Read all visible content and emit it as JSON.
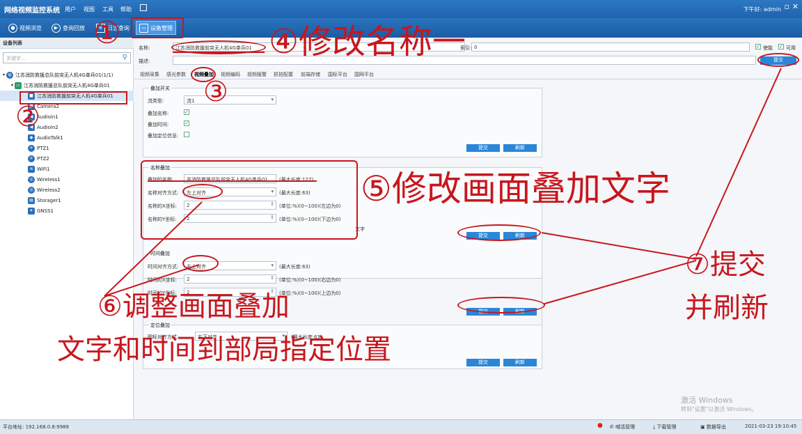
{
  "titlebar": {
    "app_title": "网络视频监控系统",
    "menus": [
      "用户",
      "视图",
      "工具",
      "帮助"
    ],
    "greeting": "下午好: admin",
    "window_controls": [
      "minimize-icon",
      "restore-icon",
      "close-icon"
    ]
  },
  "toolbar": {
    "buttons": [
      {
        "label": "视频浏览",
        "icon": "camera-icon"
      },
      {
        "label": "查询回放",
        "icon": "play-icon"
      },
      {
        "label": "日志查询",
        "icon": "log-icon"
      },
      {
        "label": "设备管理",
        "icon": "device-icon"
      }
    ]
  },
  "sidebar": {
    "header": "设备列表",
    "search_placeholder": "关键字...",
    "tree": [
      {
        "label": "江苏消防救援总队前突无人机4G单兵01(1/1)",
        "icon": "globe-icon",
        "level": 0,
        "color": "#2d6fb7"
      },
      {
        "label": "江苏消防救援总队前突无人机4G单兵01",
        "icon": "device-icon",
        "level": 1,
        "color": "#2a9a6a"
      },
      {
        "label": "江苏消防救援前突无人机4G单兵01",
        "icon": "camera-icon",
        "level": 2,
        "color": "#2d6fb7",
        "selected": true
      },
      {
        "label": "Camera2",
        "icon": "camera-icon",
        "level": 2,
        "color": "#2d6fb7"
      },
      {
        "label": "Audioin1",
        "icon": "speaker-icon",
        "level": 2,
        "color": "#2d6fb7"
      },
      {
        "label": "Audioin2",
        "icon": "speaker-icon",
        "level": 2,
        "color": "#2d6fb7"
      },
      {
        "label": "AudioTalk1",
        "icon": "talk-icon",
        "level": 2,
        "color": "#2d6fb7"
      },
      {
        "label": "PTZ1",
        "icon": "ptz-icon",
        "level": 2,
        "color": "#2d6fb7"
      },
      {
        "label": "PTZ2",
        "icon": "ptz-icon",
        "level": 2,
        "color": "#2d6fb7"
      },
      {
        "label": "WiFi1",
        "icon": "wifi-icon",
        "level": 2,
        "color": "#2d6fb7"
      },
      {
        "label": "Wireless1",
        "icon": "wireless-icon",
        "level": 2,
        "color": "#2d6fb7"
      },
      {
        "label": "Wireless2",
        "icon": "wireless-icon",
        "level": 2,
        "color": "#2d6fb7"
      },
      {
        "label": "Storager1",
        "icon": "storage-icon",
        "level": 2,
        "color": "#2d6fb7"
      },
      {
        "label": "GNSS1",
        "icon": "satellite-icon",
        "level": 2,
        "color": "#2d6fb7"
      }
    ]
  },
  "main": {
    "name_label": "名称:",
    "name_value": "江苏消防救援前突无人机4G单兵01",
    "index_label": "索引:",
    "index_value": "0",
    "desc_label": "描述:",
    "desc_value": "",
    "check_label_1": "使能",
    "check_label_2": "可用",
    "submit_top": "提交",
    "tabs": [
      "视频采集",
      "感光参数",
      "视频叠加",
      "视频编码",
      "视频报警",
      "抓拍配置",
      "前端存储",
      "国标平台",
      "国网平台"
    ],
    "active_tab": "视频叠加",
    "overlay_switch": {
      "title": "叠加开关",
      "stream_label": "流类型:",
      "stream_value": "流1",
      "rows": [
        {
          "label": "叠加名称:",
          "checked": true
        },
        {
          "label": "叠加时间:",
          "checked": true
        },
        {
          "label": "叠加定位信息:",
          "checked": false
        }
      ],
      "submit": "提交",
      "refresh": "刷新"
    },
    "name_overlay": {
      "title": "名称叠加",
      "rows": [
        {
          "label": "叠加的名称:",
          "value": "苏消防救援总队前突无人机4G单兵01",
          "hint": "(最大长度:127)"
        },
        {
          "label": "名称对齐方式:",
          "value": "左上对齐",
          "hint": "(最大长度:63)"
        },
        {
          "label": "名称的X坐标:",
          "value": "2",
          "hint": "(单位:%)(0~100)(左边为0)"
        },
        {
          "label": "名称的Y坐标:",
          "value": "2",
          "hint": "(单位:%)(0~100)(下边为0)"
        }
      ],
      "extra_text": "文字",
      "submit": "提交",
      "refresh": "刷新"
    },
    "time_overlay": {
      "title": "时间叠加",
      "rows": [
        {
          "label": "时间对齐方式:",
          "value": "右上对齐",
          "hint": "(最大长度:63)"
        },
        {
          "label": "时间的X坐标:",
          "value": "2",
          "hint": "(单位:%)(0~100)(右边为0)"
        },
        {
          "label": "时间的Y坐标:",
          "value": "2",
          "hint": "(单位:%)(0~100)(上边为0)"
        }
      ],
      "submit": "提交",
      "refresh": "刷新"
    },
    "location_overlay": {
      "title": "定位叠加",
      "rows": [
        {
          "label": "图标对齐方式:",
          "value": "右下对齐",
          "hint": "(最大长度:63)"
        }
      ],
      "submit": "提交",
      "refresh": "刷新"
    }
  },
  "statusbar": {
    "platform_address": "平台地址: 192.168.0.8:9988",
    "items": [
      "喊话管理",
      "下载管理",
      "数据导出"
    ],
    "datetime": "2021-03-23 19:10:45"
  },
  "watermark": {
    "line1": "激活 Windows",
    "line2": "转到\"设置\"以激活 Windows。"
  },
  "annotations": {
    "step1": "①",
    "step2": "②",
    "step3": "③",
    "step4": "④修改名称一",
    "step5": "⑤修改画面叠加文字",
    "step6_line1": "⑥调整画面叠加",
    "step6_line2": "文字和时间到部局指定位置",
    "step7_line1": "⑦提交",
    "step7_line2": "并刷新"
  },
  "colors": {
    "title_blue": "#1f63ad",
    "accent_blue": "#2a86d8",
    "annotation_red": "#c8161d"
  }
}
